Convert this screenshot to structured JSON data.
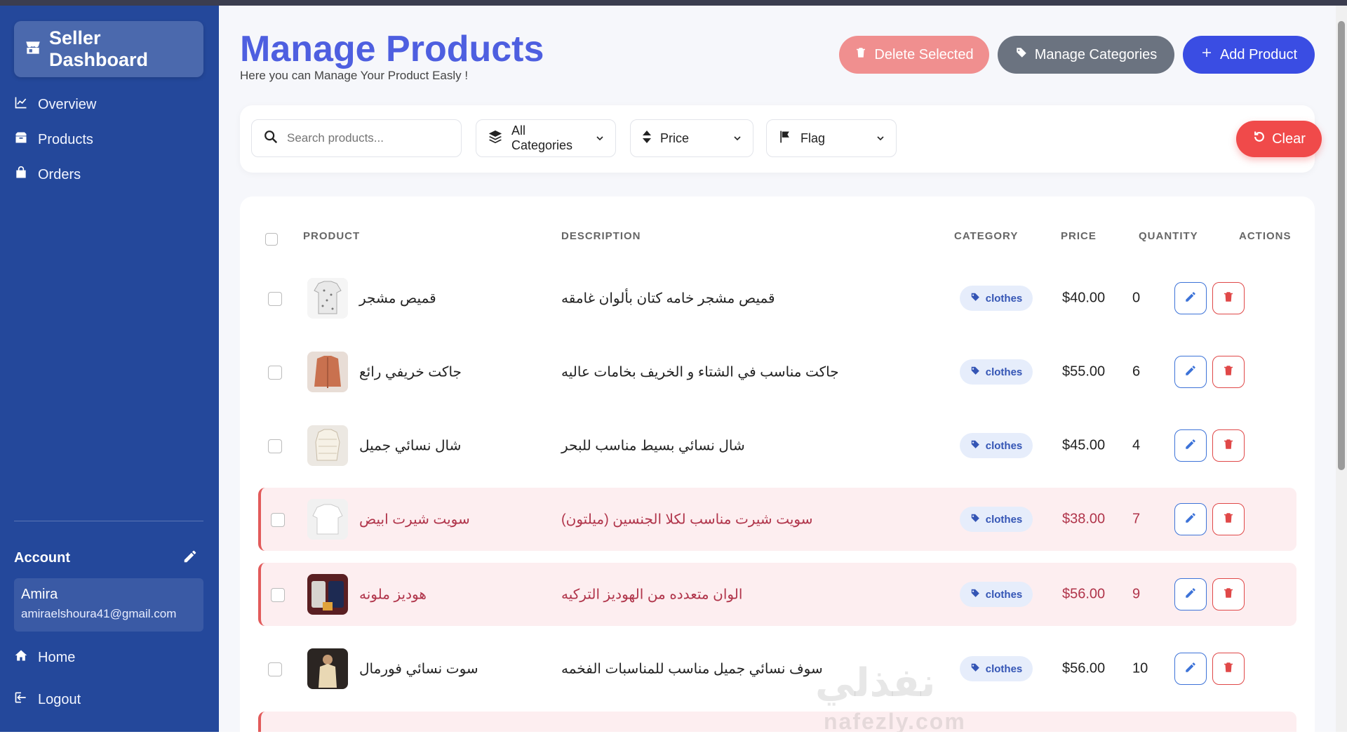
{
  "sidebar": {
    "brand": "Seller Dashboard",
    "nav": [
      {
        "label": "Overview",
        "icon": "chart-line-icon"
      },
      {
        "label": "Products",
        "icon": "box-icon"
      },
      {
        "label": "Orders",
        "icon": "shopping-bag-icon"
      }
    ],
    "account": {
      "title": "Account",
      "name": "Amira",
      "email": "amiraelshoura41@gmail.com"
    },
    "bottom_nav": [
      {
        "label": "Home",
        "icon": "home-icon"
      },
      {
        "label": "Logout",
        "icon": "logout-icon"
      }
    ]
  },
  "header": {
    "title": "Manage Products",
    "subtitle": "Here you can Manage Your Product Easly !",
    "delete_label": "Delete Selected",
    "categories_label": "Manage Categories",
    "add_label": "Add Product"
  },
  "filters": {
    "search_placeholder": "Search products...",
    "category": "All Categories",
    "price": "Price",
    "flag": "Flag",
    "clear": "Clear"
  },
  "table": {
    "columns": [
      "PRODUCT",
      "DESCRIPTION",
      "CATEGORY",
      "PRICE",
      "QUANTITY",
      "ACTIONS"
    ],
    "rows": [
      {
        "name": "قميص مشجر",
        "description": "قميص مشجر خامه كتان بألوان غامقه",
        "category": "clothes",
        "price": "$40.00",
        "quantity": "0",
        "flagged": false
      },
      {
        "name": "جاكت خريفي رائع",
        "description": "جاكت مناسب في الشتاء و الخريف بخامات عاليه",
        "category": "clothes",
        "price": "$55.00",
        "quantity": "6",
        "flagged": false
      },
      {
        "name": "شال نسائي جميل",
        "description": "شال نسائي بسيط مناسب للبحر",
        "category": "clothes",
        "price": "$45.00",
        "quantity": "4",
        "flagged": false
      },
      {
        "name": "سويت شيرت ابيض",
        "description": "سويت شيرت مناسب لكلا الجنسين (ميلتون)",
        "category": "clothes",
        "price": "$38.00",
        "quantity": "7",
        "flagged": true
      },
      {
        "name": "هوديز ملونه",
        "description": "الوان متعدده من الهوديز التركيه",
        "category": "clothes",
        "price": "$56.00",
        "quantity": "9",
        "flagged": true
      },
      {
        "name": "سوت نسائي فورمال",
        "description": "سوف نسائي جميل مناسب للمناسبات الفخمه",
        "category": "clothes",
        "price": "$56.00",
        "quantity": "10",
        "flagged": false
      }
    ]
  },
  "watermark": {
    "arabic": "نفذلي",
    "latin": "nafezly.com"
  },
  "colors": {
    "sidebar": "#24489b",
    "accent": "#3a4de3",
    "title": "#4e5fe0",
    "danger": "#f04a4a",
    "flag_row": "#fdeef0"
  }
}
